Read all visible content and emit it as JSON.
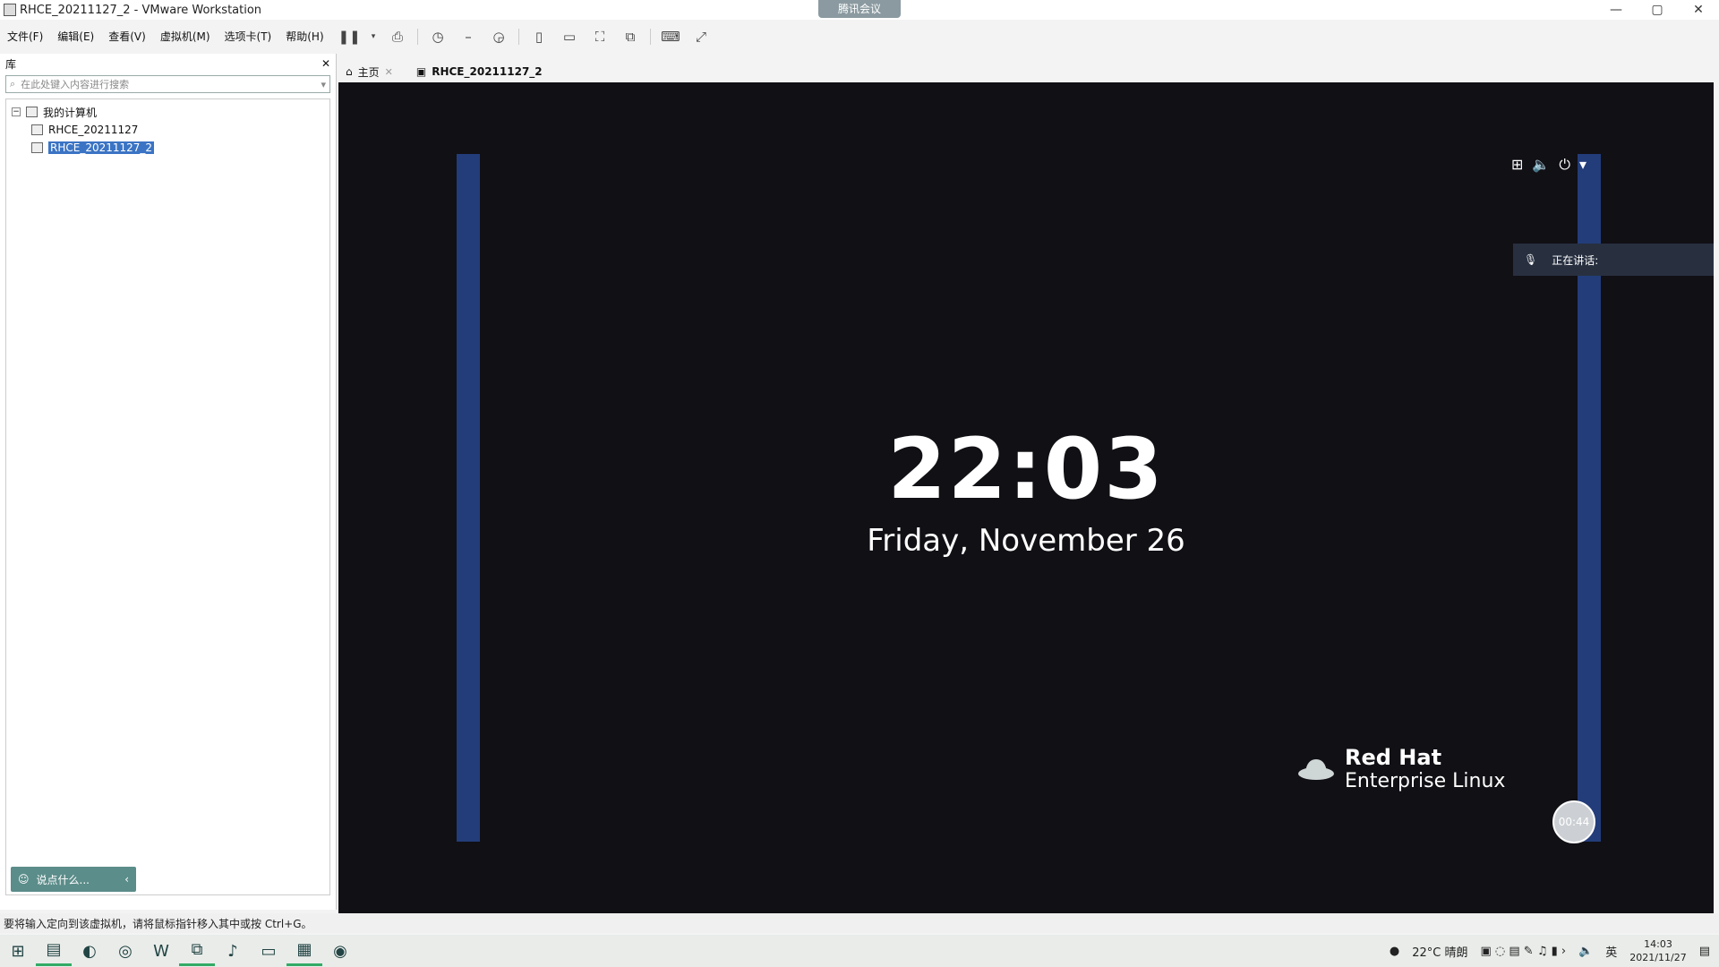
{
  "window": {
    "title": "RHCE_20211127_2 - VMware Workstation",
    "meeting_tag": "腾讯会议",
    "controls": [
      "—",
      "▢",
      "✕"
    ]
  },
  "menu": {
    "items": [
      "文件(F)",
      "编辑(E)",
      "查看(V)",
      "虚拟机(M)",
      "选项卡(T)",
      "帮助(H)"
    ]
  },
  "toolbar": {
    "icons": [
      "pause-icon",
      "dropdown-arrow-icon",
      "send-keys-icon",
      "snapshot-icon",
      "restore-snapshot-icon",
      "snapshot-manager-icon",
      "sidebar-icon",
      "thumbnail-icon",
      "fullscreen-icon",
      "unity-icon",
      "console-icon",
      "stretch-icon"
    ]
  },
  "library": {
    "title": "库",
    "close": "✕",
    "search_placeholder": "在此处键入内容进行搜索",
    "root": "我的计算机",
    "items": [
      "RHCE_20211127",
      "RHCE_20211127_2"
    ],
    "selected_index": 1
  },
  "chat": {
    "placeholder": "说点什么...",
    "arrow": "‹"
  },
  "tabs": [
    {
      "label": "主页",
      "closable": true
    },
    {
      "label": "RHCE_20211127_2",
      "closable": false
    }
  ],
  "vm": {
    "time": "22:03",
    "date": "Friday, November 26",
    "speaking_label": "正在讲话:",
    "logo_line1": "Red Hat",
    "logo_line2": "Enterprise Linux",
    "timer": "00:44",
    "colors": {
      "background": "#111015",
      "side_bar": "#233d7a"
    }
  },
  "status": {
    "message": "要将输入定向到该虚拟机，请将鼠标指针移入其中或按 Ctrl+G。"
  },
  "taskbar": {
    "weather": "22°C 晴朗",
    "lang": "英",
    "time": "14:03",
    "date": "2021/11/27"
  }
}
